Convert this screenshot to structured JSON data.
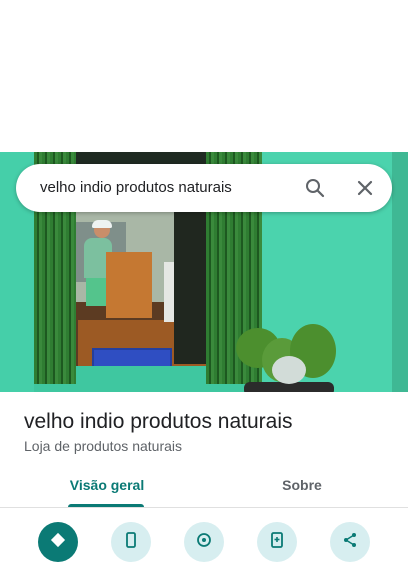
{
  "search": {
    "query": "velho indio produtos naturais"
  },
  "place": {
    "name": "velho indio produtos naturais",
    "category": "Loja de produtos naturais"
  },
  "tabs": [
    {
      "label": "Visão geral",
      "selected": true
    },
    {
      "label": "Sobre",
      "selected": false
    }
  ],
  "actions": [
    {
      "icon": "directions-icon",
      "primary": true
    },
    {
      "icon": "phone-icon",
      "primary": false
    },
    {
      "icon": "navigate-icon",
      "primary": false
    },
    {
      "icon": "save-icon",
      "primary": false
    },
    {
      "icon": "share-icon",
      "primary": false
    }
  ],
  "colors": {
    "accent": "#0b7a75",
    "action_bg": "#d7eef0",
    "text_primary": "#202124",
    "text_secondary": "#5f6368"
  }
}
